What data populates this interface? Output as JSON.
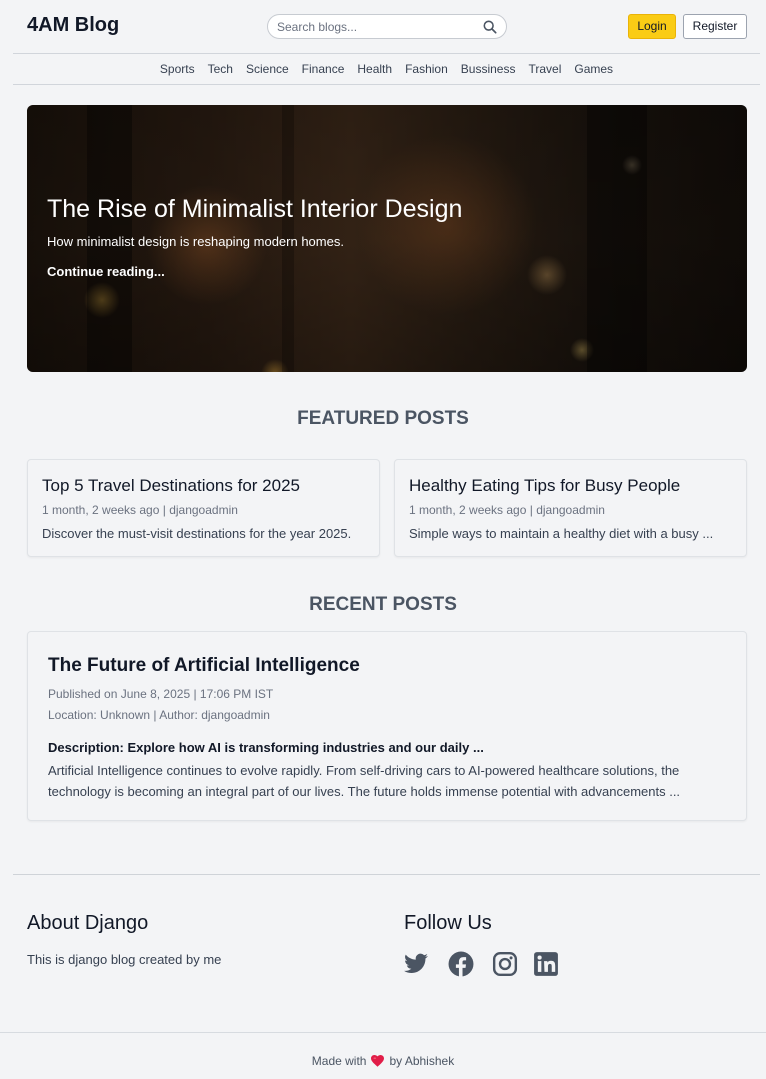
{
  "header": {
    "logo": "4AM Blog",
    "search_placeholder": "Search blogs...",
    "login_label": "Login",
    "register_label": "Register"
  },
  "categories": [
    "Sports",
    "Tech",
    "Science",
    "Finance",
    "Health",
    "Fashion",
    "Bussiness",
    "Travel",
    "Games"
  ],
  "hero": {
    "title": "The Rise of Minimalist Interior Design",
    "subtitle": "How minimalist design is reshaping modern homes.",
    "link": "Continue reading..."
  },
  "featured": {
    "heading": "FEATURED POSTS",
    "posts": [
      {
        "title": "Top 5 Travel Destinations for 2025",
        "meta": "1 month, 2 weeks ago | djangoadmin",
        "desc": "Discover the must-visit destinations for the year 2025."
      },
      {
        "title": "Healthy Eating Tips for Busy People",
        "meta": "1 month, 2 weeks ago | djangoadmin",
        "desc": "Simple ways to maintain a healthy diet with a busy ..."
      }
    ]
  },
  "recent": {
    "heading": "RECENT POSTS",
    "post": {
      "title": "The Future of Artificial Intelligence",
      "published": "Published on June 8, 2025 | 17:06 PM IST",
      "location": "Location: Unknown | Author: djangoadmin",
      "description": "Description: Explore how AI is transforming industries and our daily ...",
      "body": "Artificial Intelligence continues to evolve rapidly. From self-driving cars to AI-powered healthcare solutions, the technology is becoming an integral part of our lives. The future holds immense potential with advancements ..."
    }
  },
  "footer": {
    "about_heading": "About Django",
    "about_text": "This is django blog created by me",
    "follow_heading": "Follow Us",
    "social": [
      "twitter-icon",
      "facebook-icon",
      "instagram-icon",
      "linkedin-icon"
    ],
    "made_prefix": "Made with",
    "made_suffix": "by Abhishek"
  },
  "colors": {
    "accent": "#facc15",
    "heart": "#e11d48",
    "social_icon": "#4b5563"
  }
}
